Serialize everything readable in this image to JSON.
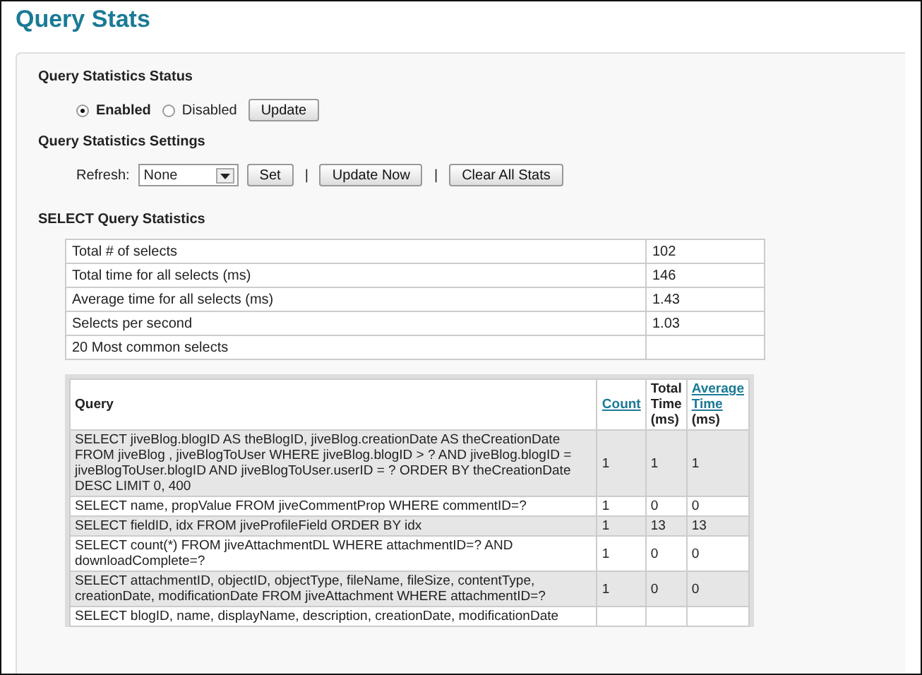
{
  "title": "Query Stats",
  "status": {
    "heading": "Query Statistics Status",
    "options": [
      {
        "label": "Enabled",
        "selected": true
      },
      {
        "label": "Disabled",
        "selected": false
      }
    ],
    "button": "Update"
  },
  "settings": {
    "heading": "Query Statistics Settings",
    "refresh_label": "Refresh:",
    "refresh_value": "None",
    "buttons": [
      "Set",
      "Update Now",
      "Clear All Stats"
    ],
    "separator": "|"
  },
  "select_stats": {
    "heading": "SELECT Query Statistics",
    "rows": [
      {
        "label": "Total # of selects",
        "value": "102"
      },
      {
        "label": "Total time for all selects (ms)",
        "value": "146"
      },
      {
        "label": "Average time for all selects (ms)",
        "value": "1.43"
      },
      {
        "label": "Selects per second",
        "value": "1.03"
      },
      {
        "label": "20 Most common selects",
        "value": ""
      }
    ]
  },
  "query_table": {
    "columns": [
      {
        "label": "Query",
        "kind": "text"
      },
      {
        "label": "Count",
        "kind": "link"
      },
      {
        "label": "Total Time (ms)",
        "kind": "text"
      },
      {
        "label": "Average Time",
        "suffix": "(ms)",
        "kind": "link"
      }
    ],
    "rows": [
      {
        "query": "SELECT jiveBlog.blogID AS theBlogID, jiveBlog.creationDate AS theCreationDate FROM jiveBlog , jiveBlogToUser WHERE jiveBlog.blogID > ? AND jiveBlog.blogID = jiveBlogToUser.blogID AND jiveBlogToUser.userID = ? ORDER BY theCreationDate DESC LIMIT 0, 400",
        "count": "1",
        "total": "1",
        "average": "1"
      },
      {
        "query": "SELECT name, propValue FROM jiveCommentProp WHERE commentID=?",
        "count": "1",
        "total": "0",
        "average": "0"
      },
      {
        "query": "SELECT fieldID, idx FROM jiveProfileField ORDER BY idx",
        "count": "1",
        "total": "13",
        "average": "13"
      },
      {
        "query": "SELECT count(*) FROM jiveAttachmentDL WHERE attachmentID=? AND downloadComplete=?",
        "count": "1",
        "total": "0",
        "average": "0"
      },
      {
        "query": "SELECT attachmentID, objectID, objectType, fileName, fileSize, contentType, creationDate, modificationDate FROM jiveAttachment WHERE attachmentID=?",
        "count": "1",
        "total": "0",
        "average": "0"
      },
      {
        "query": "SELECT blogID, name, displayName, description, creationDate, modificationDate",
        "count": "",
        "total": "",
        "average": ""
      }
    ]
  }
}
